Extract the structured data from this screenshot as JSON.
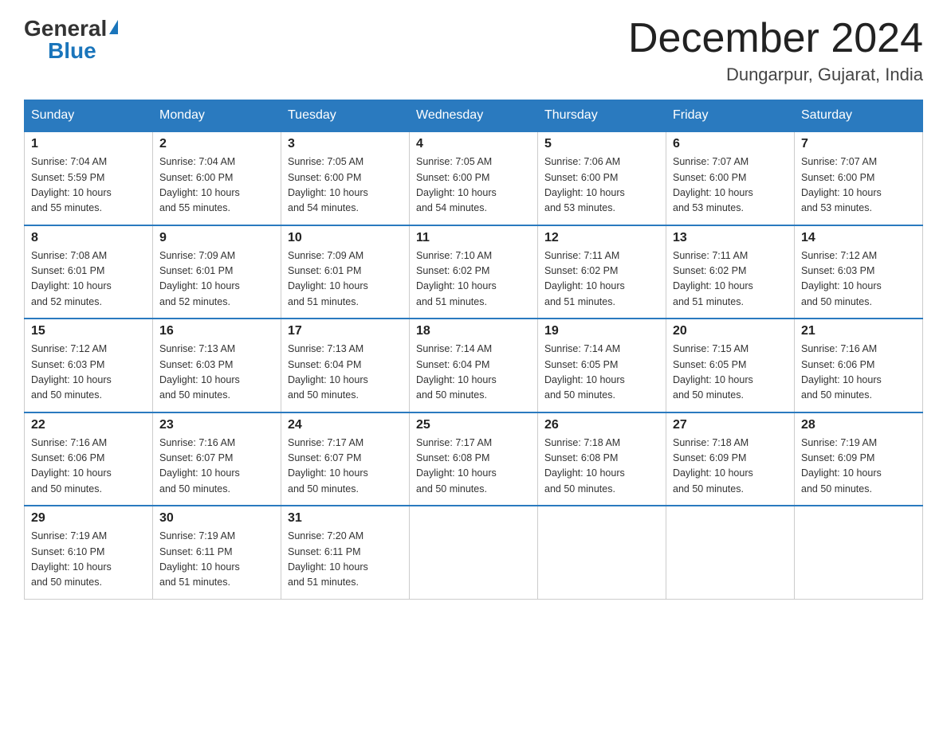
{
  "logo": {
    "general": "General",
    "blue": "Blue"
  },
  "header": {
    "month": "December 2024",
    "location": "Dungarpur, Gujarat, India"
  },
  "weekdays": [
    "Sunday",
    "Monday",
    "Tuesday",
    "Wednesday",
    "Thursday",
    "Friday",
    "Saturday"
  ],
  "weeks": [
    [
      {
        "day": "1",
        "sunrise": "7:04 AM",
        "sunset": "5:59 PM",
        "daylight": "10 hours and 55 minutes."
      },
      {
        "day": "2",
        "sunrise": "7:04 AM",
        "sunset": "6:00 PM",
        "daylight": "10 hours and 55 minutes."
      },
      {
        "day": "3",
        "sunrise": "7:05 AM",
        "sunset": "6:00 PM",
        "daylight": "10 hours and 54 minutes."
      },
      {
        "day": "4",
        "sunrise": "7:05 AM",
        "sunset": "6:00 PM",
        "daylight": "10 hours and 54 minutes."
      },
      {
        "day": "5",
        "sunrise": "7:06 AM",
        "sunset": "6:00 PM",
        "daylight": "10 hours and 53 minutes."
      },
      {
        "day": "6",
        "sunrise": "7:07 AM",
        "sunset": "6:00 PM",
        "daylight": "10 hours and 53 minutes."
      },
      {
        "day": "7",
        "sunrise": "7:07 AM",
        "sunset": "6:00 PM",
        "daylight": "10 hours and 53 minutes."
      }
    ],
    [
      {
        "day": "8",
        "sunrise": "7:08 AM",
        "sunset": "6:01 PM",
        "daylight": "10 hours and 52 minutes."
      },
      {
        "day": "9",
        "sunrise": "7:09 AM",
        "sunset": "6:01 PM",
        "daylight": "10 hours and 52 minutes."
      },
      {
        "day": "10",
        "sunrise": "7:09 AM",
        "sunset": "6:01 PM",
        "daylight": "10 hours and 51 minutes."
      },
      {
        "day": "11",
        "sunrise": "7:10 AM",
        "sunset": "6:02 PM",
        "daylight": "10 hours and 51 minutes."
      },
      {
        "day": "12",
        "sunrise": "7:11 AM",
        "sunset": "6:02 PM",
        "daylight": "10 hours and 51 minutes."
      },
      {
        "day": "13",
        "sunrise": "7:11 AM",
        "sunset": "6:02 PM",
        "daylight": "10 hours and 51 minutes."
      },
      {
        "day": "14",
        "sunrise": "7:12 AM",
        "sunset": "6:03 PM",
        "daylight": "10 hours and 50 minutes."
      }
    ],
    [
      {
        "day": "15",
        "sunrise": "7:12 AM",
        "sunset": "6:03 PM",
        "daylight": "10 hours and 50 minutes."
      },
      {
        "day": "16",
        "sunrise": "7:13 AM",
        "sunset": "6:03 PM",
        "daylight": "10 hours and 50 minutes."
      },
      {
        "day": "17",
        "sunrise": "7:13 AM",
        "sunset": "6:04 PM",
        "daylight": "10 hours and 50 minutes."
      },
      {
        "day": "18",
        "sunrise": "7:14 AM",
        "sunset": "6:04 PM",
        "daylight": "10 hours and 50 minutes."
      },
      {
        "day": "19",
        "sunrise": "7:14 AM",
        "sunset": "6:05 PM",
        "daylight": "10 hours and 50 minutes."
      },
      {
        "day": "20",
        "sunrise": "7:15 AM",
        "sunset": "6:05 PM",
        "daylight": "10 hours and 50 minutes."
      },
      {
        "day": "21",
        "sunrise": "7:16 AM",
        "sunset": "6:06 PM",
        "daylight": "10 hours and 50 minutes."
      }
    ],
    [
      {
        "day": "22",
        "sunrise": "7:16 AM",
        "sunset": "6:06 PM",
        "daylight": "10 hours and 50 minutes."
      },
      {
        "day": "23",
        "sunrise": "7:16 AM",
        "sunset": "6:07 PM",
        "daylight": "10 hours and 50 minutes."
      },
      {
        "day": "24",
        "sunrise": "7:17 AM",
        "sunset": "6:07 PM",
        "daylight": "10 hours and 50 minutes."
      },
      {
        "day": "25",
        "sunrise": "7:17 AM",
        "sunset": "6:08 PM",
        "daylight": "10 hours and 50 minutes."
      },
      {
        "day": "26",
        "sunrise": "7:18 AM",
        "sunset": "6:08 PM",
        "daylight": "10 hours and 50 minutes."
      },
      {
        "day": "27",
        "sunrise": "7:18 AM",
        "sunset": "6:09 PM",
        "daylight": "10 hours and 50 minutes."
      },
      {
        "day": "28",
        "sunrise": "7:19 AM",
        "sunset": "6:09 PM",
        "daylight": "10 hours and 50 minutes."
      }
    ],
    [
      {
        "day": "29",
        "sunrise": "7:19 AM",
        "sunset": "6:10 PM",
        "daylight": "10 hours and 50 minutes."
      },
      {
        "day": "30",
        "sunrise": "7:19 AM",
        "sunset": "6:11 PM",
        "daylight": "10 hours and 51 minutes."
      },
      {
        "day": "31",
        "sunrise": "7:20 AM",
        "sunset": "6:11 PM",
        "daylight": "10 hours and 51 minutes."
      },
      null,
      null,
      null,
      null
    ]
  ],
  "labels": {
    "sunrise": "Sunrise:",
    "sunset": "Sunset:",
    "daylight": "Daylight:"
  }
}
